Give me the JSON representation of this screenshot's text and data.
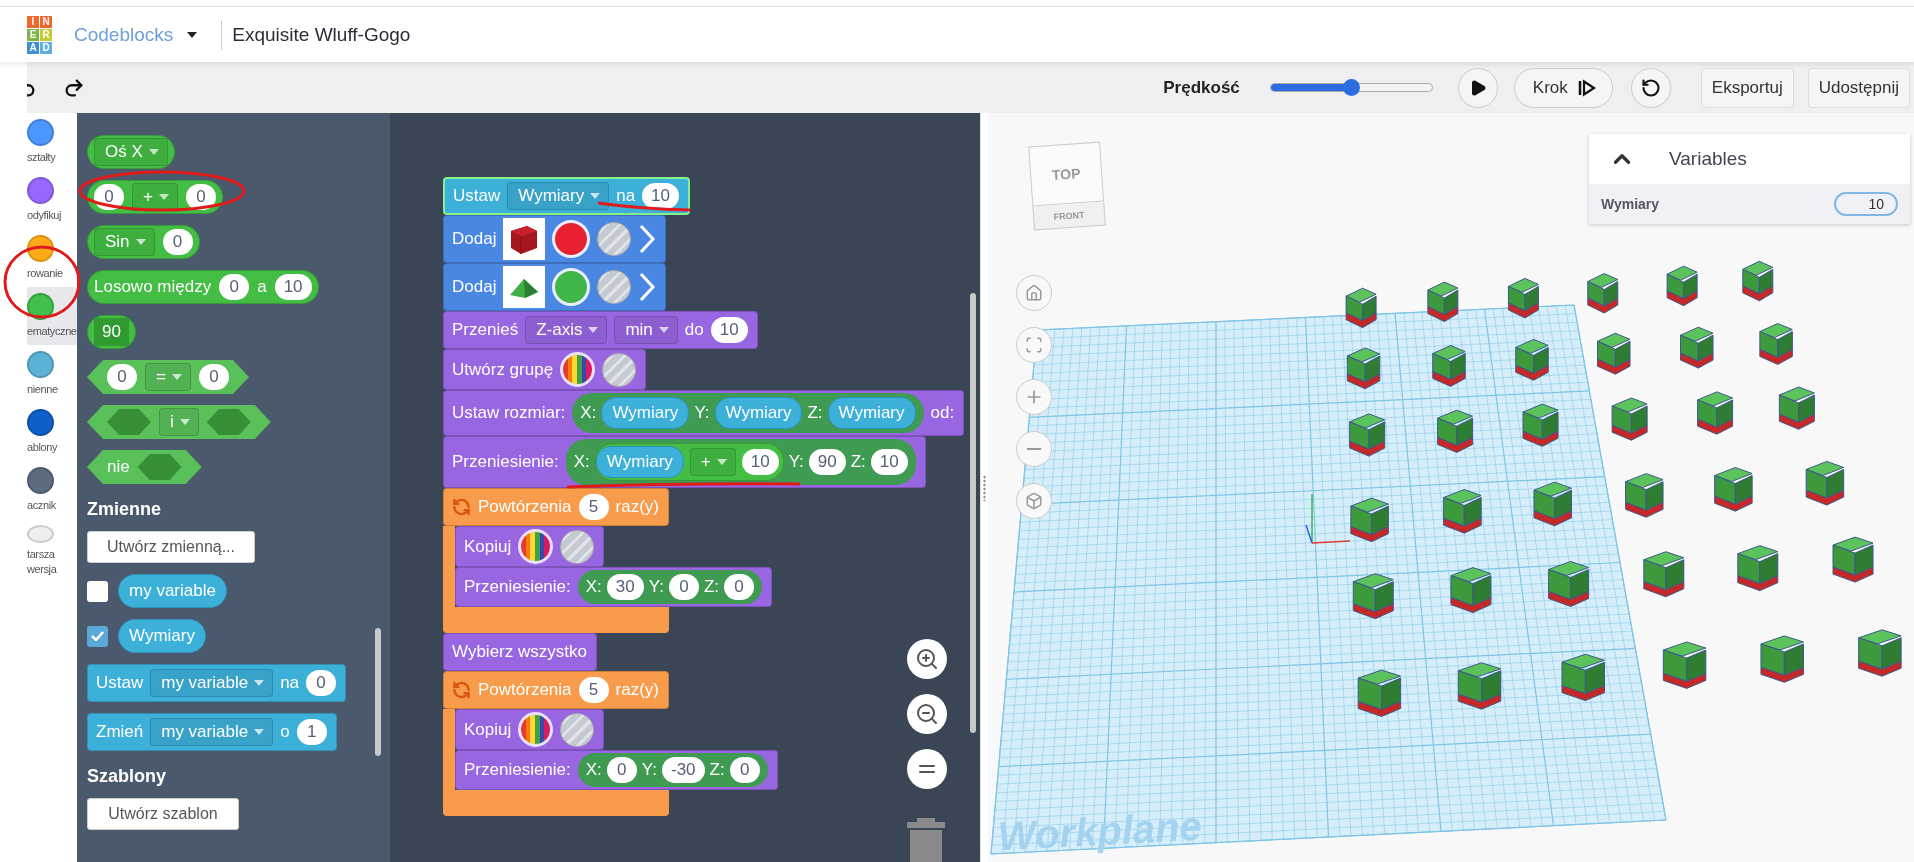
{
  "header": {
    "logo": [
      {
        "letter": "I",
        "color": "#f0662c"
      },
      {
        "letter": "N",
        "color": "#f0662c"
      },
      {
        "letter": "E",
        "color": "#7ab648"
      },
      {
        "letter": "R",
        "color": "#c2cc36"
      },
      {
        "letter": "A",
        "color": "#3c8fd0"
      },
      {
        "letter": "D",
        "color": "#5fb0e2"
      }
    ],
    "app": "Codeblocks",
    "design_title": "Exquisite Wluff-Gogo"
  },
  "toolbar": {
    "speed_label": "Prędkość",
    "speed": {
      "level": 0.5
    },
    "step_button": "Krok",
    "buttons": [
      "Eksportuj",
      "Udostępnij"
    ]
  },
  "categories": [
    {
      "label": "ształty",
      "color": "#4c97ff",
      "selected": false
    },
    {
      "label": "odyfikuj",
      "color": "#9966ff",
      "selected": false
    },
    {
      "label": "rowanie",
      "color": "#ffab19",
      "selected": false
    },
    {
      "label": "ematyczne",
      "color": "#40bf4a",
      "selected": true
    },
    {
      "label": "nienne",
      "color": "#5cb1d6",
      "selected": false
    },
    {
      "label": "ablony",
      "color": "#0e5fc7",
      "selected": false
    },
    {
      "label": "acznik",
      "color": "#5c6b80",
      "selected": false
    },
    {
      "label": "tarsza wersja",
      "color": "#eeeeee",
      "selected": false
    }
  ],
  "toolbox": {
    "items": [
      {
        "kind": "reporter",
        "color": "#44bd44",
        "parts": [
          {
            "kind": "dropdown",
            "text": "Oś X"
          }
        ]
      },
      {
        "kind": "reporter",
        "color": "#44bd44",
        "parts": [
          {
            "kind": "number",
            "text": "0"
          },
          {
            "kind": "dropdown",
            "text": "+"
          },
          {
            "kind": "number",
            "text": "0"
          }
        ]
      },
      {
        "kind": "reporter",
        "color": "#44bd44",
        "parts": [
          {
            "kind": "dropdown",
            "text": "Sin"
          },
          {
            "kind": "number",
            "text": "0"
          }
        ]
      },
      {
        "kind": "reporter",
        "color": "#44bd44",
        "parts": [
          {
            "kind": "label",
            "text": "Losowo między"
          },
          {
            "kind": "number",
            "text": "0"
          },
          {
            "kind": "label",
            "text": "a"
          },
          {
            "kind": "number",
            "text": "10"
          }
        ]
      },
      {
        "kind": "reporter",
        "color": "#44bd44",
        "parts": [
          {
            "kind": "angle",
            "text": "90"
          }
        ]
      },
      {
        "kind": "boolean",
        "color": "#59c05a",
        "parts": [
          {
            "kind": "number",
            "text": "0"
          },
          {
            "kind": "dropdown",
            "text": "="
          },
          {
            "kind": "number",
            "text": "0"
          }
        ]
      },
      {
        "kind": "boolean",
        "color": "#59c05a",
        "parts": [
          {
            "kind": "slot"
          },
          {
            "kind": "dropdown",
            "text": "i"
          },
          {
            "kind": "slot"
          }
        ]
      },
      {
        "kind": "boolean",
        "color": "#59c05a",
        "parts": [
          {
            "kind": "label",
            "text": "nie"
          },
          {
            "kind": "slot"
          }
        ]
      },
      {
        "kind": "heading",
        "text": "Zmienne"
      },
      {
        "kind": "button",
        "text": "Utwórz zmienną..."
      },
      {
        "kind": "variable",
        "text": "my variable",
        "checked": false
      },
      {
        "kind": "variable",
        "text": "Wymiary",
        "checked": true
      },
      {
        "kind": "stmt",
        "color": "#3db0da",
        "parts": [
          {
            "kind": "label",
            "text": "Ustaw"
          },
          {
            "kind": "dropdown",
            "text": "my variable"
          },
          {
            "kind": "label",
            "text": "na"
          },
          {
            "kind": "number",
            "text": "0"
          }
        ]
      },
      {
        "kind": "stmt",
        "color": "#3db0da",
        "parts": [
          {
            "kind": "label",
            "text": "Zmień"
          },
          {
            "kind": "dropdown",
            "text": "my variable"
          },
          {
            "kind": "label",
            "text": "o"
          },
          {
            "kind": "number",
            "text": "1"
          }
        ]
      },
      {
        "kind": "heading",
        "text": "Szablony"
      },
      {
        "kind": "button",
        "text": "Utwórz szablon"
      }
    ]
  },
  "workspace": {
    "blocks": [
      {
        "kind": "stmt",
        "color": "#3db0da",
        "selected": true,
        "parts": [
          {
            "kind": "label",
            "text": "Ustaw"
          },
          {
            "kind": "dropdown",
            "text": "Wymiary"
          },
          {
            "kind": "label",
            "text": "na"
          },
          {
            "kind": "number",
            "text": "10"
          }
        ]
      },
      {
        "kind": "stmt",
        "color": "#4a87e3",
        "selected": false,
        "parts": [
          {
            "kind": "label",
            "text": "Dodaj"
          },
          {
            "kind": "cube"
          },
          {
            "kind": "color",
            "color": "#e8202f"
          },
          {
            "kind": "material"
          },
          {
            "kind": "chevron"
          }
        ]
      },
      {
        "kind": "stmt",
        "color": "#4a87e3",
        "selected": false,
        "parts": [
          {
            "kind": "label",
            "text": "Dodaj"
          },
          {
            "kind": "wedge"
          },
          {
            "kind": "color",
            "color": "#3fb54a"
          },
          {
            "kind": "material"
          },
          {
            "kind": "chevron"
          }
        ]
      },
      {
        "kind": "stmt",
        "color": "#9966e2",
        "selected": false,
        "parts": [
          {
            "kind": "label",
            "text": "Przenieś"
          },
          {
            "kind": "dropdown",
            "text": "Z-axis"
          },
          {
            "kind": "dropdown",
            "text": "min"
          },
          {
            "kind": "label",
            "text": "do"
          },
          {
            "kind": "number",
            "text": "10"
          }
        ]
      },
      {
        "kind": "stmt",
        "color": "#9966e2",
        "selected": false,
        "parts": [
          {
            "kind": "label",
            "text": "Utwórz grupę"
          },
          {
            "kind": "rainbow"
          },
          {
            "kind": "material"
          }
        ]
      },
      {
        "kind": "stmt",
        "color": "#9966e2",
        "selected": false,
        "parts": [
          {
            "kind": "label",
            "text": "Ustaw rozmiar:"
          },
          {
            "kind": "vector",
            "parts": [
              {
                "kind": "label",
                "text": "X:"
              },
              {
                "kind": "variable",
                "text": "Wymiary"
              },
              {
                "kind": "label",
                "text": "Y:"
              },
              {
                "kind": "variable",
                "text": "Wymiary"
              },
              {
                "kind": "label",
                "text": "Z:"
              },
              {
                "kind": "variable",
                "text": "Wymiary"
              }
            ]
          },
          {
            "kind": "label",
            "text": "od:"
          }
        ]
      },
      {
        "kind": "stmt",
        "color": "#9966e2",
        "selected": false,
        "parts": [
          {
            "kind": "label",
            "text": "Przeniesienie:"
          },
          {
            "kind": "vector",
            "parts": [
              {
                "kind": "label",
                "text": "X:"
              },
              {
                "kind": "expression",
                "parts": [
                  {
                    "kind": "variable",
                    "text": "Wymiary"
                  },
                  {
                    "kind": "dropdown",
                    "text": "+"
                  },
                  {
                    "kind": "number",
                    "text": "10"
                  }
                ]
              },
              {
                "kind": "label",
                "text": "Y:"
              },
              {
                "kind": "number",
                "text": "90"
              },
              {
                "kind": "label",
                "text": "Z:"
              },
              {
                "kind": "number",
                "text": "10"
              }
            ]
          }
        ]
      },
      {
        "kind": "loop",
        "color": "#f89c4b",
        "selected": false,
        "parts": [
          {
            "kind": "loop-icon"
          },
          {
            "kind": "label",
            "text": "Powtórzenia"
          },
          {
            "kind": "number",
            "text": "5"
          },
          {
            "kind": "label",
            "text": "raz(y)"
          }
        ],
        "children": [
          {
            "kind": "stmt",
            "color": "#9966e2",
            "parts": [
              {
                "kind": "label",
                "text": "Kopiuj"
              },
              {
                "kind": "rainbow"
              },
              {
                "kind": "material"
              }
            ]
          },
          {
            "kind": "stmt",
            "color": "#9966e2",
            "parts": [
              {
                "kind": "label",
                "text": "Przeniesienie:"
              },
              {
                "kind": "vector",
                "parts": [
                  {
                    "kind": "label",
                    "text": "X:"
                  },
                  {
                    "kind": "number",
                    "text": "30"
                  },
                  {
                    "kind": "label",
                    "text": "Y:"
                  },
                  {
                    "kind": "number",
                    "text": "0"
                  },
                  {
                    "kind": "label",
                    "text": "Z:"
                  },
                  {
                    "kind": "number",
                    "text": "0"
                  }
                ]
              }
            ]
          }
        ]
      },
      {
        "kind": "stmt",
        "color": "#9966e2",
        "selected": false,
        "parts": [
          {
            "kind": "label",
            "text": "Wybierz wszystko"
          }
        ]
      },
      {
        "kind": "loop",
        "color": "#f89c4b",
        "selected": false,
        "parts": [
          {
            "kind": "loop-icon"
          },
          {
            "kind": "label",
            "text": "Powtórzenia"
          },
          {
            "kind": "number",
            "text": "5"
          },
          {
            "kind": "label",
            "text": "raz(y)"
          }
        ],
        "children": [
          {
            "kind": "stmt",
            "color": "#9966e2",
            "parts": [
              {
                "kind": "label",
                "text": "Kopiuj"
              },
              {
                "kind": "rainbow"
              },
              {
                "kind": "material"
              }
            ]
          },
          {
            "kind": "stmt",
            "color": "#9966e2",
            "parts": [
              {
                "kind": "label",
                "text": "Przeniesienie:"
              },
              {
                "kind": "vector",
                "parts": [
                  {
                    "kind": "label",
                    "text": "X:"
                  },
                  {
                    "kind": "number",
                    "text": "0"
                  },
                  {
                    "kind": "label",
                    "text": "Y:"
                  },
                  {
                    "kind": "number",
                    "text": "-30"
                  },
                  {
                    "kind": "label",
                    "text": "Z:"
                  },
                  {
                    "kind": "number",
                    "text": "0"
                  }
                ]
              }
            ]
          }
        ]
      }
    ]
  },
  "viewport": {
    "view_cube": {
      "top": "TOP",
      "front": "FRONT"
    },
    "workplane_label": "Workplane",
    "variables_panel": {
      "title": "Variables",
      "rows": [
        {
          "name": "Wymiary",
          "value": "10"
        }
      ]
    }
  }
}
